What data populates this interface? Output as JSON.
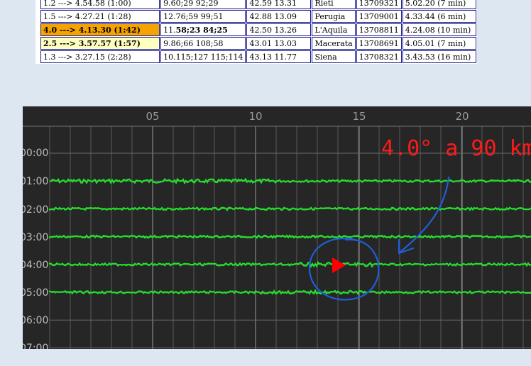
{
  "table": {
    "rows": [
      [
        "1.2 ---> 4.54.58 (1:00)",
        "9.60;29 92;29",
        "42.59 13.31",
        "Rieti",
        "13709321",
        "5.02.20 (7 min)"
      ],
      [
        "1.5 ---> 4.27.21 (1:28)",
        "12.76;59 99;51",
        "42.88 13.09",
        "Perugia",
        "13709001",
        "4.33.44 (6 min)"
      ],
      [
        "4.0 ---> 4.13.30 (1:42)",
        "11.58;23 84;25",
        "42.50 13.26",
        "L'Aquila",
        "13708811",
        "4.24.08 (10 min)"
      ],
      [
        "2.5 ---> 3.57.57 (1:57)",
        "9.86;66 108;58",
        "43.01 13.03",
        "Macerata",
        "13708691",
        "4.05.01 (7 min)"
      ],
      [
        "1.3 ---> 3.27.15 (2:28)",
        "10.115;127 115;114",
        "43.13 11.77",
        "Siena",
        "13708321",
        "3.43.53 (16 min)"
      ]
    ],
    "bold_second_col_row": 2,
    "highlight_colors": {
      "orange": "#f5a300",
      "yellow": "#ffffc0"
    }
  },
  "seismograph": {
    "x_ticks": [
      "05",
      "10",
      "15",
      "20"
    ],
    "y_labels": [
      "00:00",
      "01:00",
      "02:00",
      "03:00",
      "04:00",
      "05:00",
      "06:00",
      "07:00"
    ],
    "trace_color": "#22e02b",
    "background": "#262626",
    "annotation_text": "4.0° a 90 km",
    "annotation_color": "#ff1a1a",
    "marker_color": "#ff0000",
    "pen_color": "#1f5fd6"
  }
}
